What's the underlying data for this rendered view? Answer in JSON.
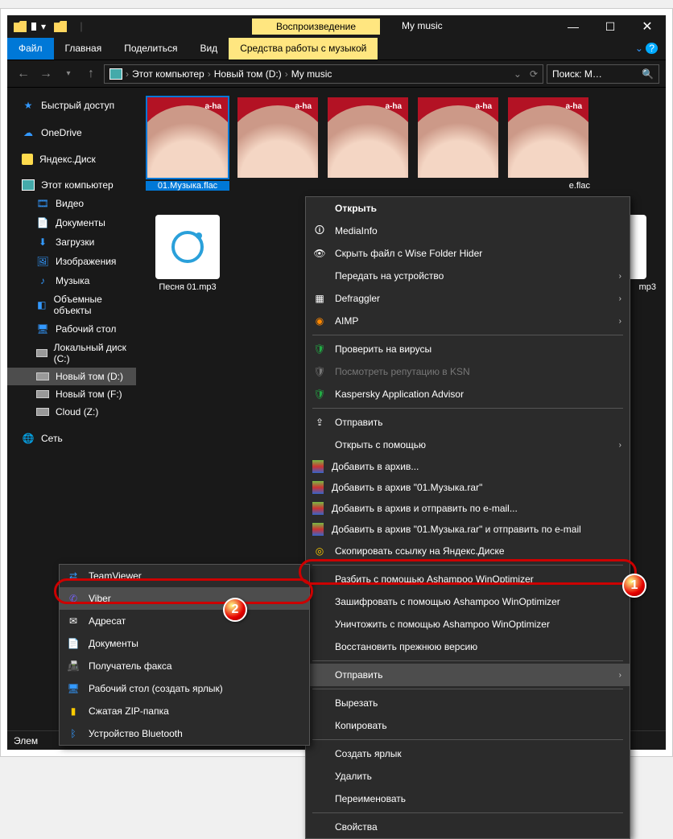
{
  "titlebar": {
    "playback_label": "Воспроизведение",
    "title": "My music"
  },
  "ribbon": {
    "file": "Файл",
    "home": "Главная",
    "share": "Поделиться",
    "view": "Вид",
    "music_tools": "Средства работы с музыкой"
  },
  "nav": {
    "breadcrumbs": [
      "Этот компьютер",
      "Новый том (D:)",
      "My music"
    ],
    "search_placeholder": "Поиск: M…"
  },
  "sidebar": {
    "quick_access": "Быстрый доступ",
    "onedrive": "OneDrive",
    "yandex_disk": "Яндекс.Диск",
    "this_pc": "Этот компьютер",
    "items": [
      {
        "label": "Видео"
      },
      {
        "label": "Документы"
      },
      {
        "label": "Загрузки"
      },
      {
        "label": "Изображения"
      },
      {
        "label": "Музыка"
      },
      {
        "label": "Объемные объекты"
      },
      {
        "label": "Рабочий стол"
      },
      {
        "label": "Локальный диск (C:)"
      },
      {
        "label": "Новый том (D:)"
      },
      {
        "label": "Новый том (F:)"
      },
      {
        "label": "Cloud (Z:)"
      }
    ],
    "network": "Сеть"
  },
  "content": {
    "selected_label": "01.Музыка.flac",
    "flac_last_label": "e.flac",
    "mp3_1": "Песня 01.mp3",
    "mp3_last": "mp3"
  },
  "context_menu": {
    "open": "Открыть",
    "mediainfo": "MediaInfo",
    "wise_hider": "Скрыть файл с Wise Folder Hider",
    "cast": "Передать на устройство",
    "defraggler": "Defraggler",
    "aimp": "AIMP",
    "virus_check": "Проверить на вирусы",
    "ksn": "Посмотреть репутацию в KSN",
    "kaspersky_advisor": "Kaspersky Application Advisor",
    "share_item": "Отправить",
    "open_with": "Открыть с помощью",
    "add_archive": "Добавить в архив...",
    "add_archive_named": "Добавить в архив \"01.Музыка.rar\"",
    "archive_email": "Добавить в архив и отправить по e-mail...",
    "archive_named_email": "Добавить в архив \"01.Музыка.rar\" и отправить по e-mail",
    "yadisk_link": "Скопировать ссылку на Яндекс.Диске",
    "ashampoo_split": "Разбить с помощью Ashampoo WinOptimizer",
    "ashampoo_encrypt": "Зашифровать с помощью Ashampoo WinOptimizer",
    "ashampoo_destroy": "Уничтожить с помощью Ashampoo WinOptimizer",
    "restore_prev": "Восстановить прежнюю версию",
    "send_to": "Отправить",
    "cut": "Вырезать",
    "copy": "Копировать",
    "shortcut": "Создать ярлык",
    "delete": "Удалить",
    "rename": "Переименовать",
    "properties": "Свойства"
  },
  "submenu": {
    "teamviewer": "TeamViewer",
    "viber": "Viber",
    "address": "Адресат",
    "documents": "Документы",
    "fax": "Получатель факса",
    "desktop_shortcut": "Рабочий стол (создать ярлык)",
    "zip": "Сжатая ZIP-папка",
    "bluetooth": "Устройство Bluetooth"
  },
  "statusbar": {
    "text": "Элем"
  }
}
